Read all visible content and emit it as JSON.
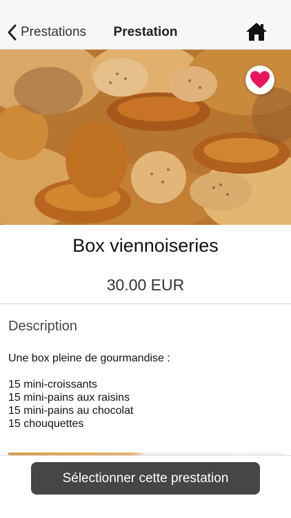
{
  "navbar": {
    "back_label": "Prestations",
    "title": "Prestation",
    "home_icon": "home-icon"
  },
  "hero": {
    "image_subject": "bread-and-pastries-photo",
    "favorite_icon": "heart-icon",
    "favorite_color": "#e8155b"
  },
  "product": {
    "title": "Box viennoiseries",
    "price": "30.00 EUR"
  },
  "description": {
    "heading": "Description",
    "intro": "Une box pleine de gourmandise :",
    "items": [
      "15 mini-croissants",
      "15 mini-pains aux raisins",
      "15 mini-pains au chocolat",
      "15 chouquettes"
    ]
  },
  "cta": {
    "label": "Sélectionner cette prestation",
    "color": "#464646"
  }
}
